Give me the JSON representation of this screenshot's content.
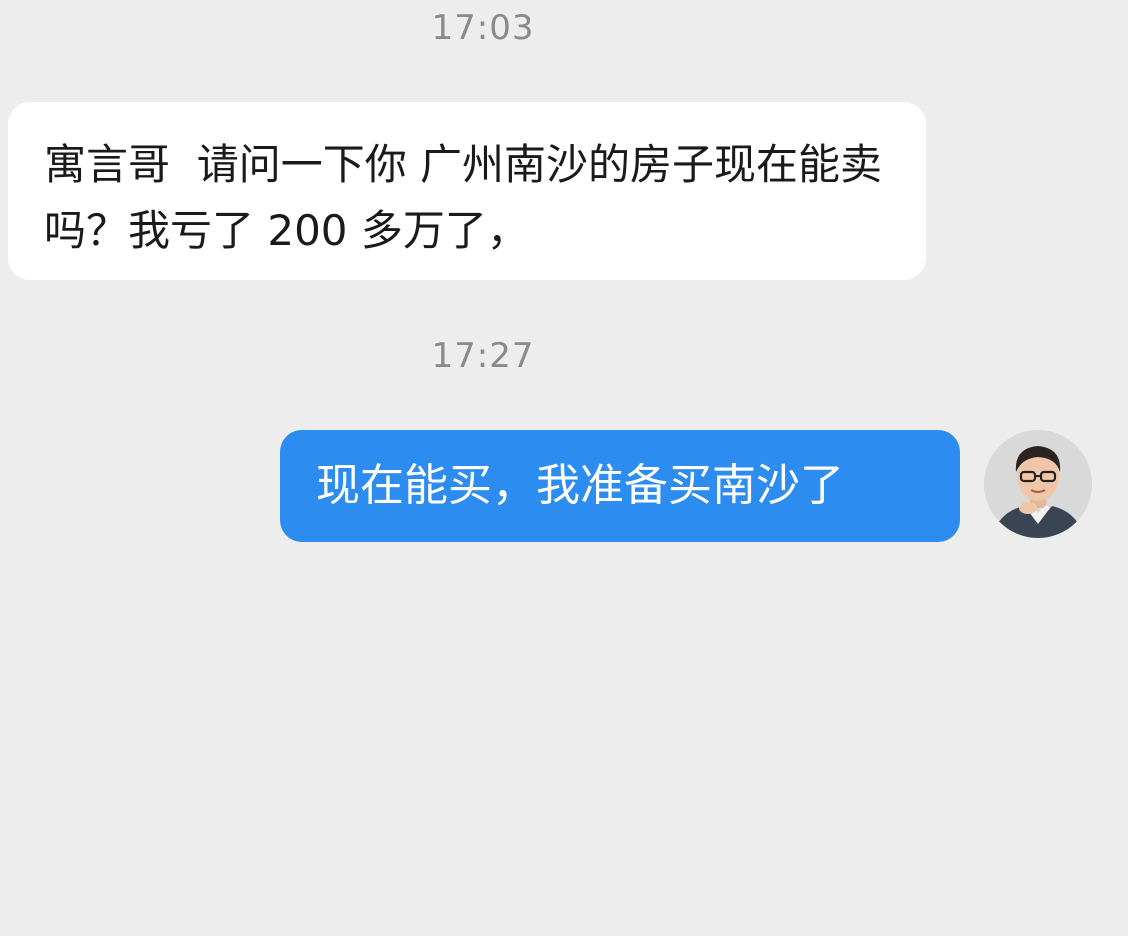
{
  "messages": [
    {
      "timestamp": "17:03",
      "direction": "incoming",
      "text": "寓言哥  请问一下你 广州南沙的房子现在能卖吗？我亏了 200 多万了，"
    },
    {
      "timestamp": "17:27",
      "direction": "outgoing",
      "text": "现在能买，我准备买南沙了"
    }
  ],
  "colors": {
    "background": "#ededed",
    "incoming_bubble": "#ffffff",
    "outgoing_bubble": "#2d8cf0",
    "timestamp_text": "#8a8a8a"
  },
  "avatar": {
    "icon": "user-avatar-photo"
  }
}
